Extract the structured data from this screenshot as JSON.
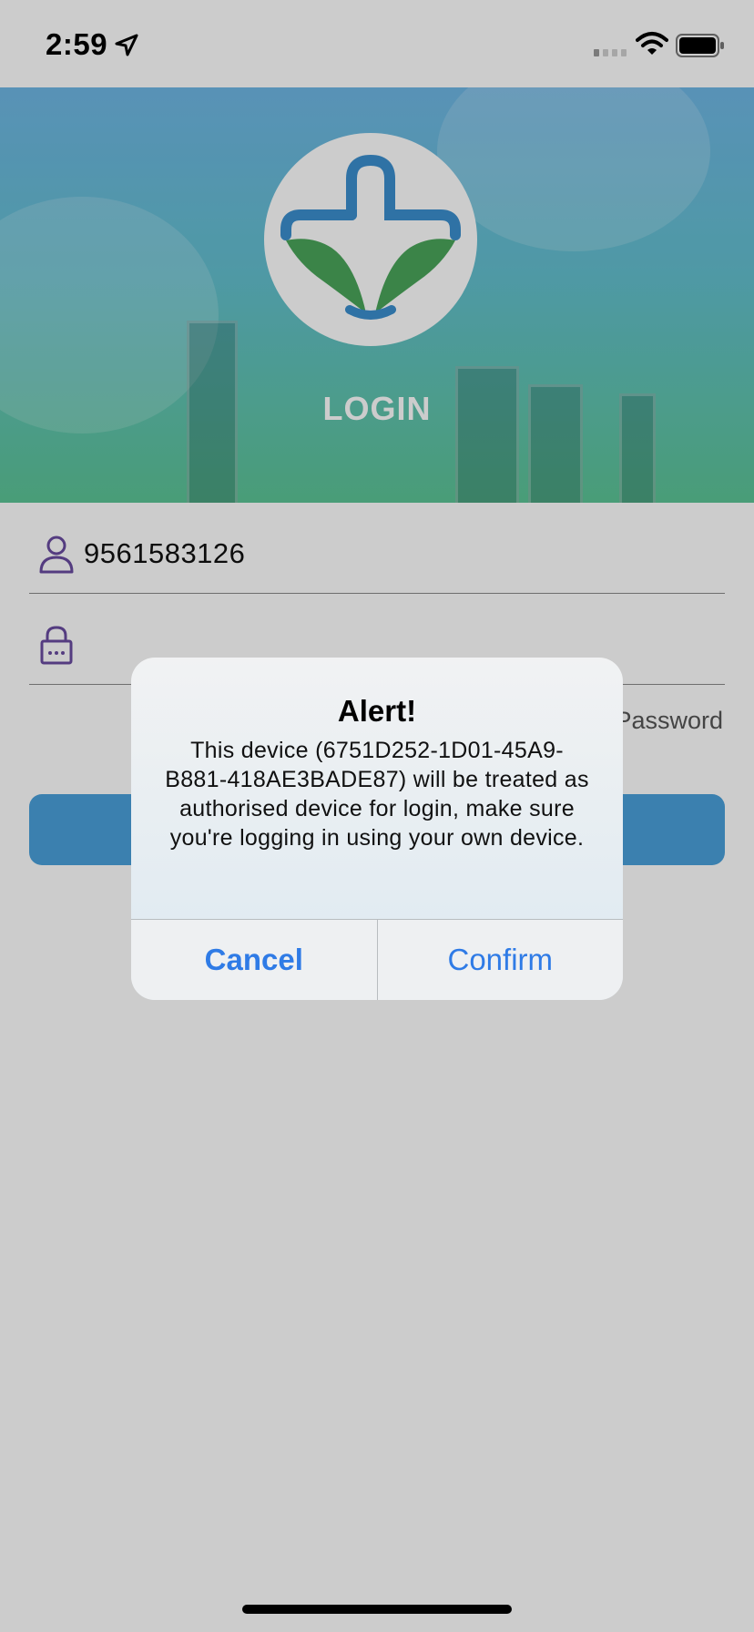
{
  "status_bar": {
    "time": "2:59",
    "icons": [
      "location-arrow-icon",
      "cellular-signal-icon",
      "wifi-icon",
      "battery-icon"
    ]
  },
  "header": {
    "title": "LOGIN",
    "logo": "medical-cross-hands-logo"
  },
  "form": {
    "username_value": "9561583126",
    "password_value": "",
    "forgot_label": "Password",
    "username_icon": "user-icon",
    "password_icon": "lock-icon",
    "login_button_label": ""
  },
  "alert": {
    "title": "Alert!",
    "message": "This device (6751D252-1D01-45A9-B881-418AE3BADE87) will be treated as authorised device for login, make sure you're logging in using your own device.",
    "cancel_label": "Cancel",
    "confirm_label": "Confirm"
  },
  "colors": {
    "accent": "#4aa0db",
    "alert_button": "#2f7be6",
    "logo_blue": "#3b8fcf",
    "logo_green": "#4aa65a",
    "icon_purple": "#6a4ca0"
  }
}
